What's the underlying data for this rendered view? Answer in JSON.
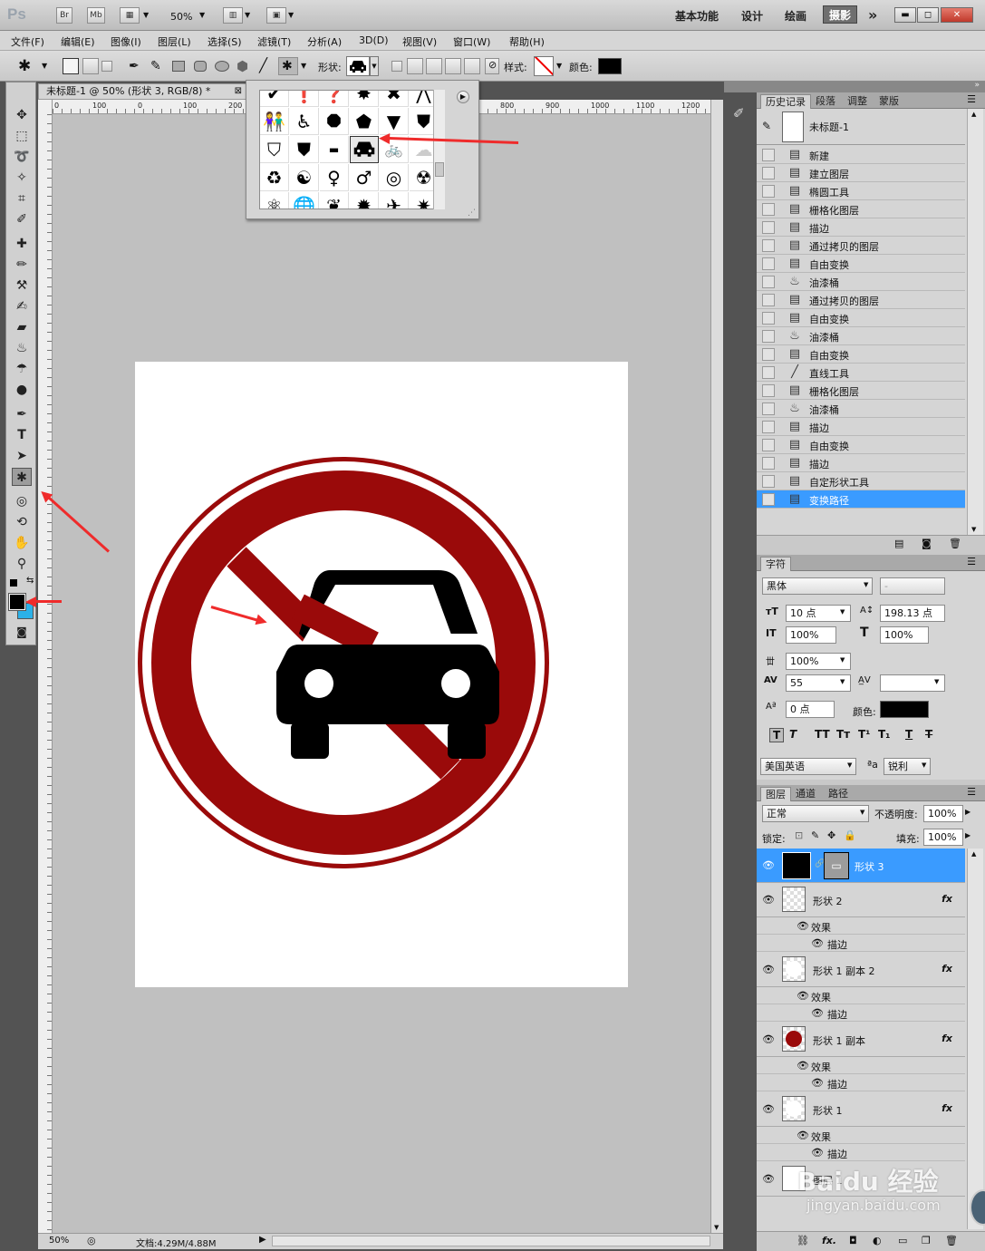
{
  "appbar": {
    "logo": "Ps",
    "bridge": "Br",
    "minibridge": "Mb",
    "zoom": "50%",
    "workspaces": [
      "基本功能",
      "设计",
      "绘画",
      "摄影"
    ],
    "active_workspace": "摄影",
    "more": "»"
  },
  "menu": [
    "文件(F)",
    "编辑(E)",
    "图像(I)",
    "图层(L)",
    "选择(S)",
    "滤镜(T)",
    "分析(A)",
    "3D(D)",
    "视图(V)",
    "窗口(W)",
    "帮助(H)"
  ],
  "options": {
    "shape_label": "形状:",
    "style_label": "样式:",
    "color_label": "颜色:",
    "color_value": "#000000"
  },
  "document": {
    "tab_title": "未标题-1 @ 50% (形状 3, RGB/8) *",
    "ruler_top": [
      "0",
      "100",
      "0",
      "100",
      "200",
      "800",
      "900",
      "1000",
      "1100",
      "1200"
    ],
    "status_zoom": "50%",
    "status_doc": "文档:4.29M/4.88M"
  },
  "history": {
    "tabs": [
      "历史记录",
      "段落",
      "调整",
      "蒙版"
    ],
    "snapshot": "未标题-1",
    "items": [
      "新建",
      "建立图层",
      "椭圆工具",
      "栅格化图层",
      "描边",
      "通过拷贝的图层",
      "自由变换",
      "油漆桶",
      "通过拷贝的图层",
      "自由变换",
      "油漆桶",
      "自由变换",
      "直线工具",
      "栅格化图层",
      "油漆桶",
      "描边",
      "自由变换",
      "描边",
      "自定形状工具",
      "变换路径"
    ],
    "selected_index": 19
  },
  "character": {
    "tab": "字符",
    "font": "黑体",
    "style": "-",
    "size": "10 点",
    "leading": "198.13 点",
    "vscale": "100%",
    "hscale": "100%",
    "tracking_pct": "100%",
    "kerning": "55",
    "baseline": "0 点",
    "color_label": "颜色:",
    "language": "美国英语",
    "aa_label": "ªa",
    "antialias": "锐利"
  },
  "layers": {
    "tabs": [
      "图层",
      "通道",
      "路径"
    ],
    "blend": "正常",
    "opacity_label": "不透明度:",
    "opacity": "100%",
    "lock_label": "锁定:",
    "fill_label": "填充:",
    "fill": "100%",
    "effect_label": "效果",
    "stroke_label": "描边",
    "items": [
      "形状 3",
      "形状 2",
      "形状 1 副本 2",
      "形状 1 副本",
      "形状 1",
      "图层 1"
    ]
  },
  "watermark": {
    "text": "Baidu 经验",
    "url": "jingyan.baidu.com"
  },
  "colors": {
    "sign_red": "#9a0a0a",
    "selection_blue": "#3a9bff",
    "arrow_red": "#ef2b2b"
  }
}
